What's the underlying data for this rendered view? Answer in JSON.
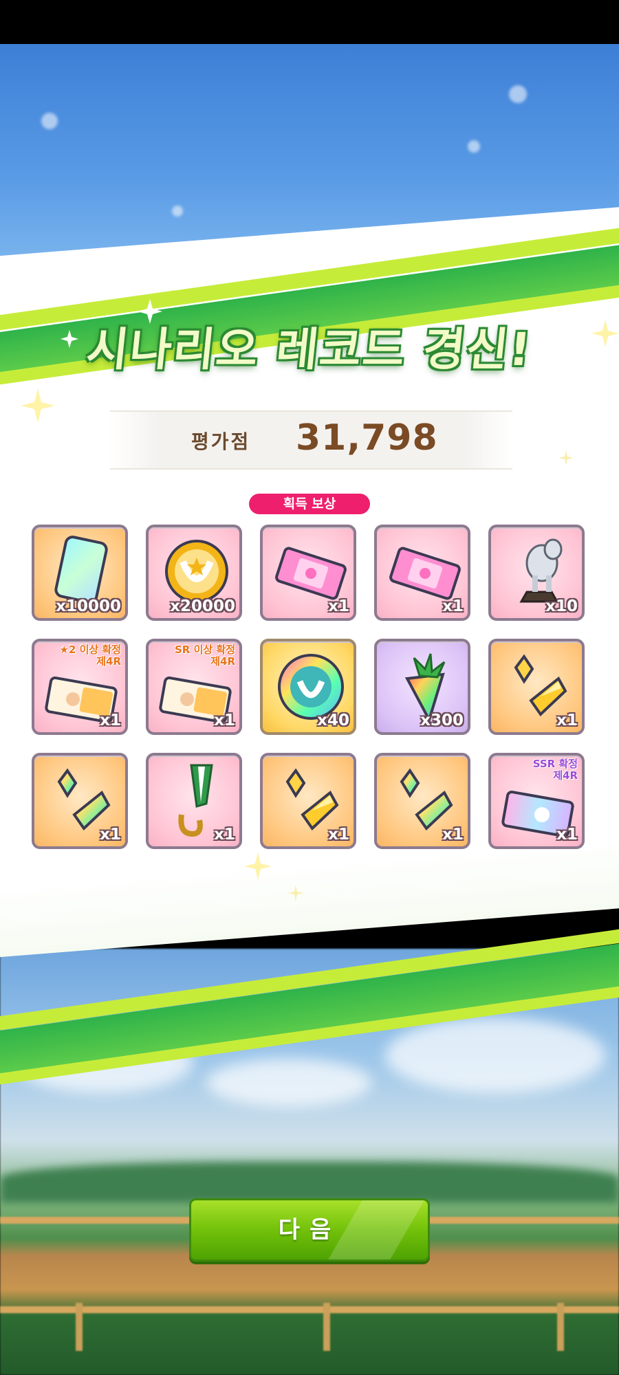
{
  "title": "시나리오 레코드 경신!",
  "score": {
    "label": "평가점",
    "value": "31,798"
  },
  "rewards_label": "획득 보상",
  "rewards": [
    {
      "icon": "jewel-icon",
      "qty": "x10000",
      "tone": "orange"
    },
    {
      "icon": "money-coin-icon",
      "qty": "x20000",
      "tone": "pink"
    },
    {
      "icon": "pink-ticket-icon",
      "qty": "x1",
      "tone": "pink"
    },
    {
      "icon": "pink-ticket-icon",
      "qty": "x1",
      "tone": "pink"
    },
    {
      "icon": "trophy-statue-icon",
      "qty": "x10",
      "tone": "pink"
    },
    {
      "icon": "guaranteed-ticket-icon",
      "qty": "x1",
      "tone": "pink",
      "badge": [
        "★2 이상 확정",
        "제4R"
      ]
    },
    {
      "icon": "guaranteed-ticket-icon",
      "qty": "x1",
      "tone": "pink",
      "badge": [
        "SR 이상 확정",
        "제4R"
      ]
    },
    {
      "icon": "rainbow-horseshoe-icon",
      "qty": "x40",
      "tone": "gold"
    },
    {
      "icon": "rainbow-carrot-icon",
      "qty": "x300",
      "tone": "purple"
    },
    {
      "icon": "gold-crystal-icon",
      "qty": "x1",
      "tone": "orange"
    },
    {
      "icon": "rainbow-crystal-icon",
      "qty": "x1",
      "tone": "orange"
    },
    {
      "icon": "medal-icon",
      "qty": "x1",
      "tone": "pink"
    },
    {
      "icon": "gold-crystal-icon",
      "qty": "x1",
      "tone": "orange"
    },
    {
      "icon": "rainbow-crystal-icon",
      "qty": "x1",
      "tone": "orange"
    },
    {
      "icon": "ssr-ticket-icon",
      "qty": "x1",
      "tone": "pink",
      "badge": [
        "SSR 확정",
        "제4R"
      ]
    }
  ],
  "next_button": "다음",
  "colors": {
    "title_fill": "#f2fbc8",
    "title_outline": "#2c8a33",
    "score_text": "#7a4b24",
    "rewards_pill": "#ee1f6c",
    "button_green": "#72c10a",
    "stripe_green": "#2fb34a",
    "stripe_lime": "#c6ec3a"
  }
}
